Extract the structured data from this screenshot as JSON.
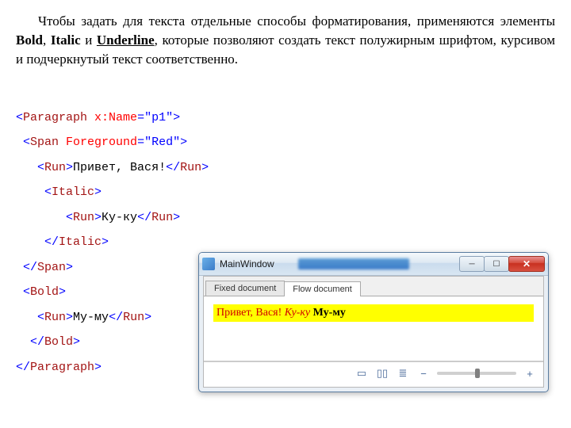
{
  "paragraph": {
    "pre": "Чтобы задать для текста отдельные способы форматирования, применяются элементы ",
    "bold": "Bold",
    "sep1": ", ",
    "italic": "Italic",
    "sep2": " и ",
    "underline": "Underline",
    "post": ", которые позволяют создать текст полужирным шрифтом, курсивом и подчеркнутый текст соответственно."
  },
  "code": {
    "l1": {
      "o": "<",
      "t": "Paragraph",
      "sp": " ",
      "a": "x:Name",
      "eq": "=",
      "v": "\"p1\"",
      "c": ">"
    },
    "l2": {
      "o": " <",
      "t": "Span",
      "sp": " ",
      "a": "Foreground",
      "eq": "=",
      "v": "\"Red\"",
      "c": ">"
    },
    "l3": {
      "o": "   <",
      "t": "Run",
      "c": ">",
      "txt": "Привет, Вася!",
      "co": "</",
      "ct": "Run",
      "cc": ">"
    },
    "l4": {
      "o": "    <",
      "t": "Italic",
      "c": ">"
    },
    "l5": {
      "o": "       <",
      "t": "Run",
      "c": ">",
      "txt": "Ку-ку",
      "co": "</",
      "ct": "Run",
      "cc": ">"
    },
    "l6": {
      "o": "    </",
      "t": "Italic",
      "c": ">"
    },
    "l7": {
      "o": " </",
      "t": "Span",
      "c": ">"
    },
    "l8": {
      "o": " <",
      "t": "Bold",
      "c": ">"
    },
    "l9": {
      "o": "   <",
      "t": "Run",
      "c": ">",
      "txt": "Му-му",
      "co": "</",
      "ct": "Run",
      "cc": ">"
    },
    "l10": {
      "o": "  </",
      "t": "Bold",
      "c": ">"
    },
    "l11": {
      "o": "</",
      "t": "Paragraph",
      "c": ">"
    }
  },
  "window": {
    "title": "MainWindow",
    "tabs": {
      "fixed": "Fixed document",
      "flow": "Flow document"
    },
    "content": {
      "greet": "Привет, Вася! ",
      "italic": "Ку-ку ",
      "bold": "Му-му"
    },
    "zoom": {
      "minus": "−",
      "plus": "+"
    }
  }
}
